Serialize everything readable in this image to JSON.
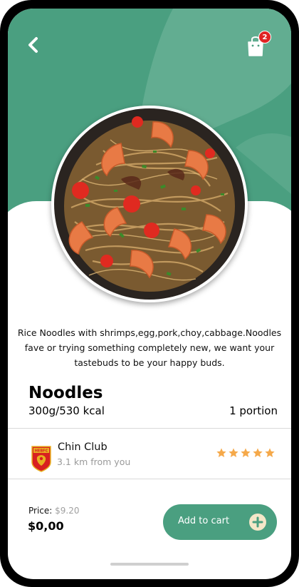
{
  "header": {
    "back_icon": "chevron-left-icon",
    "cart_icon": "shopping-bag-icon",
    "cart_count": "2"
  },
  "food": {
    "image_icon": "noodles-plate-image",
    "description": "Rice Noodles with shrimps,egg,pork,choy,cabbage.Noodles fave or trying something completely new, we want your tastebuds to be your happy buds.",
    "name": "Noodles",
    "weight_kcal": "300g/530 kcal",
    "portion": "1 portion"
  },
  "restaurant": {
    "logo_icon": "club-crest-logo",
    "logo_text": "HEBFC",
    "name": "Chin Club",
    "distance": "3.1 km from you",
    "rating": 5
  },
  "purchase": {
    "price_label": "Price:",
    "price_old": "$9.20",
    "price_value": "$0,00",
    "add_button_label": "Add to cart",
    "add_icon": "plus-circle-icon"
  },
  "colors": {
    "accent": "#4a9f80",
    "star": "#f5a94a",
    "badge": "#e02424"
  }
}
